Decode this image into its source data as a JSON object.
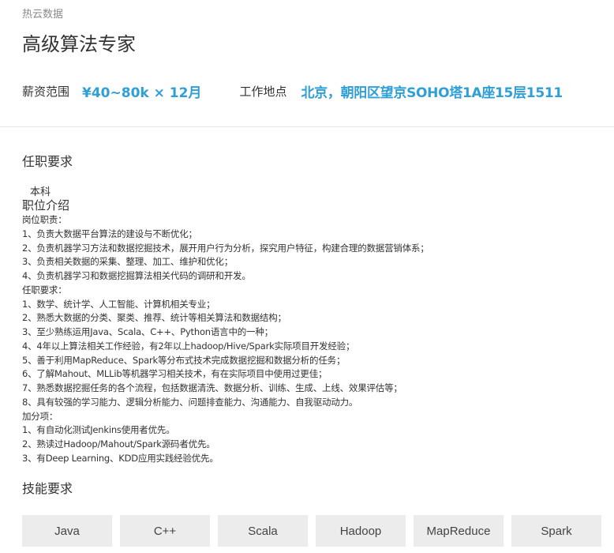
{
  "company": "热云数据",
  "job_title": "高级算法专家",
  "salary": {
    "label": "薪资范围",
    "value": "¥40~80k × 12月"
  },
  "location": {
    "label": "工作地点",
    "value": "北京，朝阳区望京SOHO塔1A座15层1511"
  },
  "requirements": {
    "title": "任职要求",
    "education": "本科"
  },
  "intro": {
    "title": "职位介绍",
    "lines": [
      "岗位职责：",
      "1、负责大数据平台算法的建设与不断优化；",
      "2、负责机器学习方法和数据挖掘技术，展开用户行为分析，探究用户特征，构建合理的数据营销体系；",
      "3、负责相关数据的采集、整理、加工、维护和优化；",
      "4、负责机器学习和数据挖掘算法相关代码的调研和开发。",
      "任职要求：",
      "1、数学、统计学、人工智能、计算机相关专业；",
      "2、熟悉大数据的分类、聚类、推荐、统计等相关算法和数据结构；",
      "3、至少熟练运用Java、Scala、C++、Python语言中的一种；",
      "4、4年以上算法相关工作经验，有2年以上hadoop/Hive/Spark实际项目开发经验；",
      "5、善于利用MapReduce、Spark等分布式技术完成数据挖掘和数据分析的任务；",
      "6、了解Mahout、MLLib等机器学习相关技术，有在实际项目中使用过更佳；",
      "7、熟悉数据挖掘任务的各个流程，包括数据清洗、数据分析、训练、生成、上线、效果评估等；",
      "8、具有较强的学习能力、逻辑分析能力、问题排查能力、沟通能力、自我驱动动力。",
      "加分项：",
      "1、有自动化测试Jenkins使用者优先。",
      "2、熟读过Hadoop/Mahout/Spark源码者优先。",
      "3、有Deep Learning、KDD应用实践经验优先。"
    ]
  },
  "skills": {
    "title": "技能要求",
    "items": [
      "Java",
      "C++",
      "Scala",
      "Hadoop",
      "MapReduce",
      "Spark"
    ]
  },
  "colors": {
    "accent": "#2f9fd8",
    "tag_bg": "#ececec",
    "divider": "#e6e6e6",
    "muted": "#8a8a8a"
  }
}
